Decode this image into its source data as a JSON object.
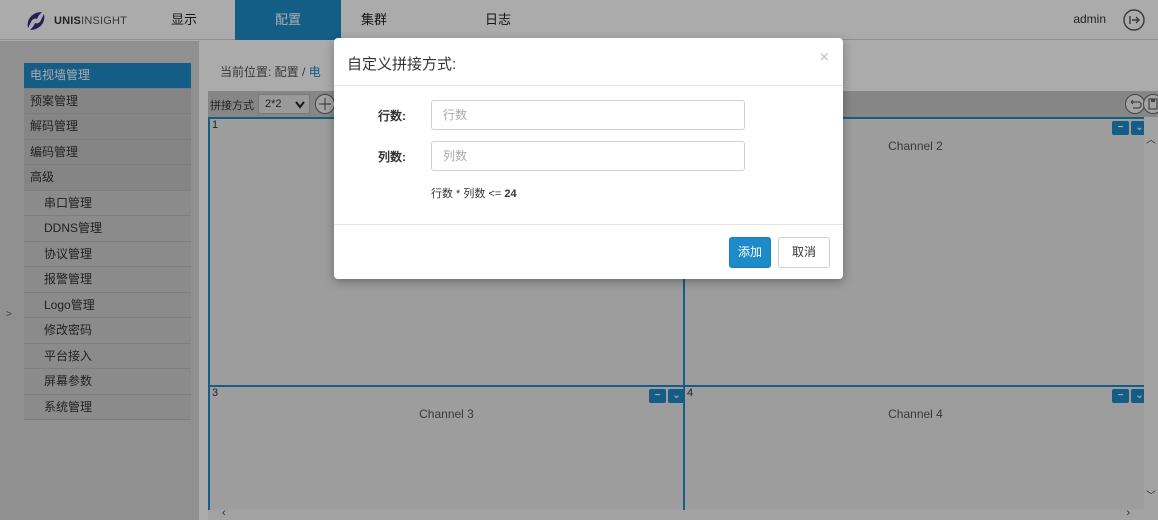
{
  "header": {
    "logo_bold": "UNIS",
    "logo_light": "INSIGHT",
    "nav": [
      "显示",
      "配置",
      "集群",
      "日志"
    ],
    "active_nav": "配置",
    "user": "admin",
    "logout_icon": "logout-icon"
  },
  "sidebar": {
    "items": [
      {
        "label": "电视墙管理",
        "sub": false,
        "active": true
      },
      {
        "label": "预案管理",
        "sub": false
      },
      {
        "label": "解码管理",
        "sub": false
      },
      {
        "label": "编码管理",
        "sub": false
      },
      {
        "label": "高级",
        "sub": false
      },
      {
        "label": "串口管理",
        "sub": true
      },
      {
        "label": "DDNS管理",
        "sub": true
      },
      {
        "label": "协议管理",
        "sub": true
      },
      {
        "label": "报警管理",
        "sub": true
      },
      {
        "label": "Logo管理",
        "sub": true
      },
      {
        "label": "修改密码",
        "sub": true
      },
      {
        "label": "平台接入",
        "sub": true
      },
      {
        "label": "屏幕参数",
        "sub": true
      },
      {
        "label": "系统管理",
        "sub": true
      }
    ],
    "collapse_glyph": ">"
  },
  "main": {
    "breadcrumb_prefix": "当前位置: 配置 /",
    "breadcrumb_current": "电",
    "toolbar": {
      "label": "拼接方式",
      "layout_value": "2*2"
    },
    "cells": [
      {
        "num": "1",
        "label": ""
      },
      {
        "num": "",
        "label": "Channel 2"
      },
      {
        "num": "3",
        "label": "Channel 3"
      },
      {
        "num": "4",
        "label": "Channel 4"
      }
    ]
  },
  "modal": {
    "title": "自定义拼接方式:",
    "close": "×",
    "rows_label": "行数:",
    "rows_placeholder": "行数",
    "cols_label": "列数:",
    "cols_placeholder": "列数",
    "hint_prefix": "行数 * 列数 <= ",
    "hint_value": "24",
    "add_button": "添加",
    "cancel_button": "取消"
  },
  "colors": {
    "accent": "#1d8bc9",
    "sidebar_bg": "#d7d7d7"
  }
}
